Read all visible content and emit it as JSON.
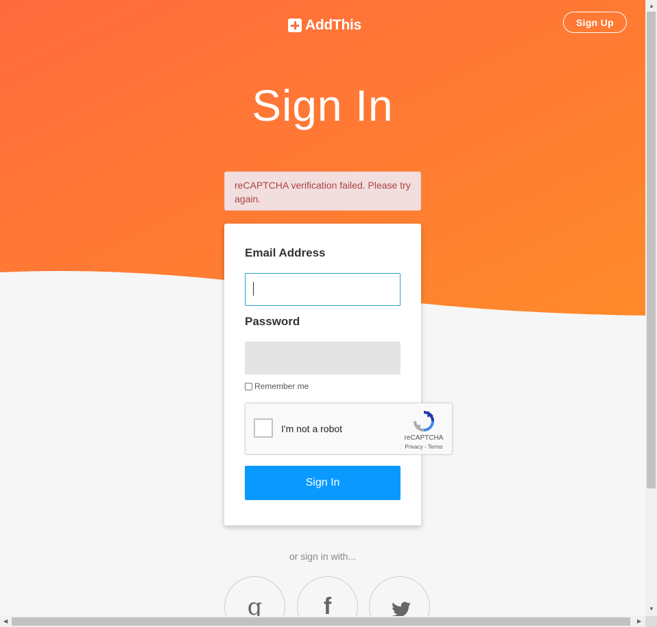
{
  "header": {
    "logo_text": "AddThis",
    "signup_label": "Sign Up"
  },
  "page": {
    "title": "Sign In"
  },
  "alert": {
    "message": "reCAPTCHA verification failed. Please try again."
  },
  "form": {
    "email_label": "Email Address",
    "email_value": "",
    "password_label": "Password",
    "password_value": "",
    "remember_label": "Remember me",
    "remember_checked": false,
    "submit_label": "Sign In"
  },
  "recaptcha": {
    "checkbox_label": "I'm not a robot",
    "brand": "reCAPTCHA",
    "links": "Privacy - Terms"
  },
  "social": {
    "prompt": "or sign in with...",
    "providers": [
      {
        "name": "google",
        "icon": "google-icon"
      },
      {
        "name": "facebook",
        "icon": "facebook-icon"
      },
      {
        "name": "twitter",
        "icon": "twitter-icon"
      }
    ]
  },
  "colors": {
    "hero_start": "#ff6a3d",
    "hero_end": "#ff8a2a",
    "primary_button": "#0a99ff",
    "alert_bg": "#f2dede",
    "alert_text": "#a94442"
  }
}
